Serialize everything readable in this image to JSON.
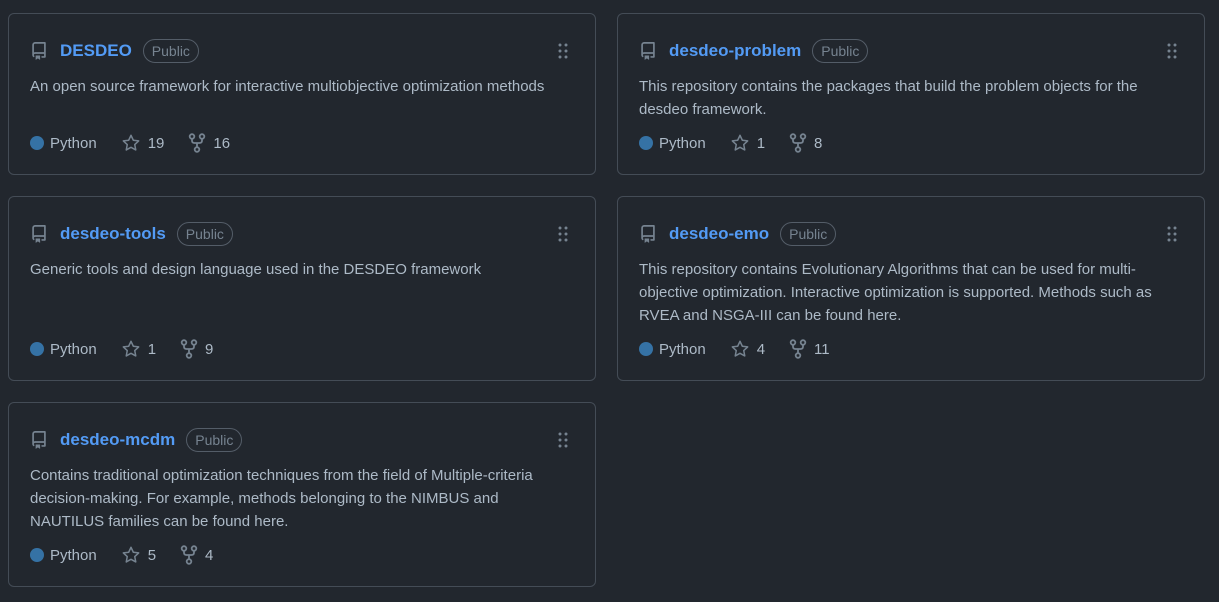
{
  "repos": [
    {
      "name": "DESDEO",
      "visibility": "Public",
      "description": "An open source framework for interactive multiobjective optimization methods",
      "language": "Python",
      "stars": "19",
      "forks": "16"
    },
    {
      "name": "desdeo-problem",
      "visibility": "Public",
      "description": "This repository contains the packages that build the problem objects for the desdeo framework.",
      "language": "Python",
      "stars": "1",
      "forks": "8"
    },
    {
      "name": "desdeo-tools",
      "visibility": "Public",
      "description": "Generic tools and design language used in the DESDEO framework",
      "language": "Python",
      "stars": "1",
      "forks": "9"
    },
    {
      "name": "desdeo-emo",
      "visibility": "Public",
      "description": "This repository contains Evolutionary Algorithms that can be used for multi-objective optimization. Interactive optimization is supported. Methods such as RVEA and NSGA-III can be found here.",
      "language": "Python",
      "stars": "4",
      "forks": "11"
    },
    {
      "name": "desdeo-mcdm",
      "visibility": "Public",
      "description": "Contains traditional optimization techniques from the field of Multiple-criteria decision-making. For example, methods belonging to the NIMBUS and NAUTILUS families can be found here.",
      "language": "Python",
      "stars": "5",
      "forks": "4"
    }
  ],
  "colors": {
    "background": "#22272e",
    "border": "#444c56",
    "link": "#539bf5",
    "python": "#3572a5"
  }
}
